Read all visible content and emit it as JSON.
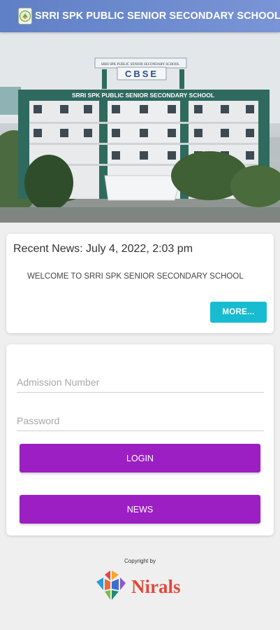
{
  "header": {
    "title": "SRRI SPK PUBLIC SENIOR SECONDARY SCHOOL",
    "logo_icon": "school-logo-icon",
    "background": "#6b87cf"
  },
  "hero": {
    "sign_top": "SRRI SPK PUBLIC SENIOR SECONDARY SCHOOL",
    "sign_board": "CBSE",
    "sign_facade": "SRRI SPK PUBLIC SENIOR SECONDARY SCHOOL"
  },
  "news": {
    "heading": "Recent News: July 4, 2022, 2:03 pm",
    "text": "WELCOME TO SRRI SPK SENIOR SECONDARY SCHOOL",
    "more_label": "MORE...",
    "accent": "#17bcd0"
  },
  "login": {
    "admission_placeholder": "Admission Number",
    "password_placeholder": "Password",
    "login_label": "LOGIN",
    "news_label": "NEWS",
    "button_color": "#9b1fc2"
  },
  "footer": {
    "copyright": "Copyright by",
    "brand": "Nirals",
    "brand_color": "#e04a3a"
  }
}
